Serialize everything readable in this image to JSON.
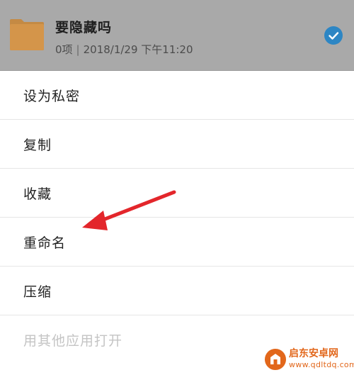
{
  "file": {
    "name": "要隐藏吗",
    "count": "0项",
    "separator": "|",
    "datetime": "2018/1/29 下午11:20",
    "icon": "folder-icon",
    "selected": true
  },
  "menu": {
    "items": [
      {
        "label": "设为私密",
        "enabled": true
      },
      {
        "label": "复制",
        "enabled": true
      },
      {
        "label": "收藏",
        "enabled": true
      },
      {
        "label": "重命名",
        "enabled": true
      },
      {
        "label": "压缩",
        "enabled": true
      },
      {
        "label": "用其他应用打开",
        "enabled": false
      }
    ]
  },
  "annotation": {
    "type": "arrow",
    "color": "#e3262b",
    "points_to": "重命名"
  },
  "watermark": {
    "title": "启东安卓网",
    "url": "www.qdltdq.com"
  },
  "colors": {
    "header_bg": "#a9a9a9",
    "accent": "#2d86c4",
    "folder": "#d4954a",
    "disabled_text": "#c4c4c4",
    "watermark": "#e2671b"
  }
}
